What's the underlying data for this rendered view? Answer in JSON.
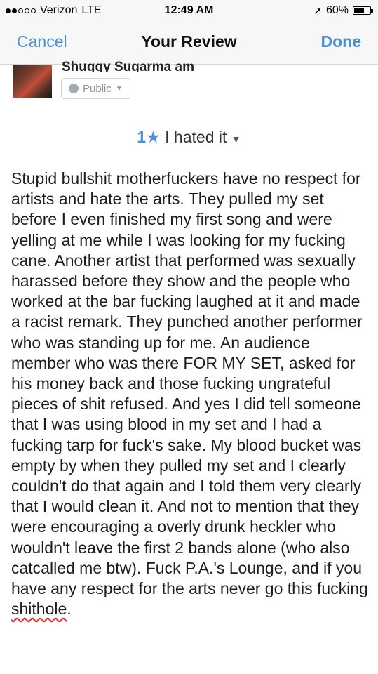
{
  "status": {
    "carrier": "Verizon",
    "network": "LTE",
    "time": "12:49 AM",
    "battery": "60%",
    "battery_level": 0.6,
    "signal_bars_filled": 2,
    "signal_bars_total": 5
  },
  "nav": {
    "cancel_label": "Cancel",
    "title": "Your Review",
    "done_label": "Done"
  },
  "author": {
    "name": "Shuggy Sugarma am",
    "privacy_label": "Public"
  },
  "rating": {
    "value": "1",
    "star": "★",
    "label": "I hated it"
  },
  "review": {
    "text_main": "Stupid bullshit motherfuckers have no respect for artists and hate the arts. They pulled my set before I even finished my first song and were yelling at me while I was looking for my fucking cane. Another artist that performed was sexually harassed before they show and the people who worked at the bar fucking laughed at it and made a racist remark. They punched another performer who was standing up for me. An audience member who was there FOR MY SET, asked for his money back and those fucking ungrateful pieces of shit refused. And yes I did tell someone that I was using blood in my set and I had a fucking tarp for fuck's sake. My blood bucket was empty by when they pulled my set and I clearly couldn't do that again and I told them very clearly that I would clean it. And not to mention that they were encouraging a overly drunk heckler who wouldn't leave the first 2 bands alone (who also catcalled me btw). Fuck P.A.'s Lounge, and if you have any respect for the arts never go this fucking",
    "text_last_word": "shithole",
    "text_end": "."
  },
  "colors": {
    "accent": "#4a90d9",
    "spellcheck": "#e03030"
  }
}
